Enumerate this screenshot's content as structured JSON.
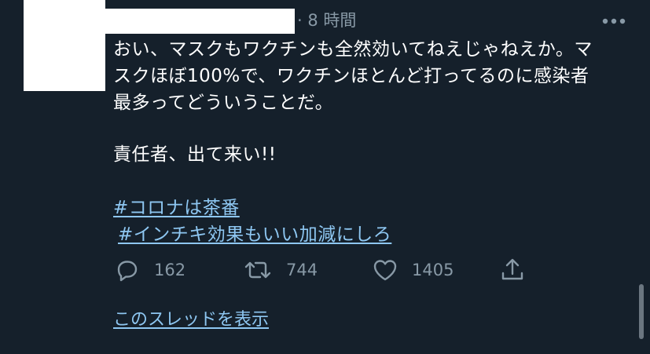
{
  "tweet": {
    "timestamp": "· 8 時間",
    "body_lines": [
      "おい、マスクもワクチンも全然効いてねえじゃねえか。マ",
      "スクほぼ100%で、ワクチンほとんど打ってるのに感染者",
      "最多ってどういうことだ。"
    ],
    "body_line2": "責任者、出て来い!!",
    "hashtags": [
      "#コロナは茶番",
      "#インチキ効果もいい加減にしろ"
    ],
    "actions": {
      "reply_count": "162",
      "retweet_count": "744",
      "like_count": "1405"
    },
    "show_thread_label": "このスレッドを表示"
  },
  "icons": {
    "more": "more-horizontal-icon",
    "reply": "reply-bubble-icon",
    "retweet": "retweet-icon",
    "like": "heart-icon",
    "share": "share-icon"
  },
  "colors": {
    "background": "#15202b",
    "text": "#ffffff",
    "muted": "#8899a6",
    "link": "#8ec7f2"
  }
}
